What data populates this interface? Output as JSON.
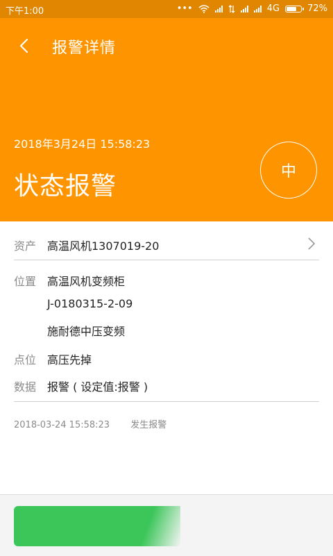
{
  "status_bar": {
    "time": "下午1:00",
    "network": "4G",
    "battery_percent": "72%",
    "battery_level": 0.72
  },
  "header": {
    "title": "报警详情",
    "datetime": "2018年3月24日  15:58:23",
    "status_title": "状态报警",
    "level": "中",
    "background_color": "#fe9500"
  },
  "details": {
    "asset_label": "资产",
    "asset_value": "高温风机1307019-20",
    "location_label": "位置",
    "location_lines": [
      "高温风机变频柜",
      "J-0180315-2-09",
      "施耐德中压变频"
    ],
    "point_label": "点位",
    "point_value": "高压先掉",
    "data_label": "数据",
    "data_value": "报警 ( 设定值:报警 )"
  },
  "log": {
    "time": "2018-03-24  15:58:23",
    "event": "发生报警"
  },
  "bottom": {
    "button_color": "#3cc65a"
  }
}
